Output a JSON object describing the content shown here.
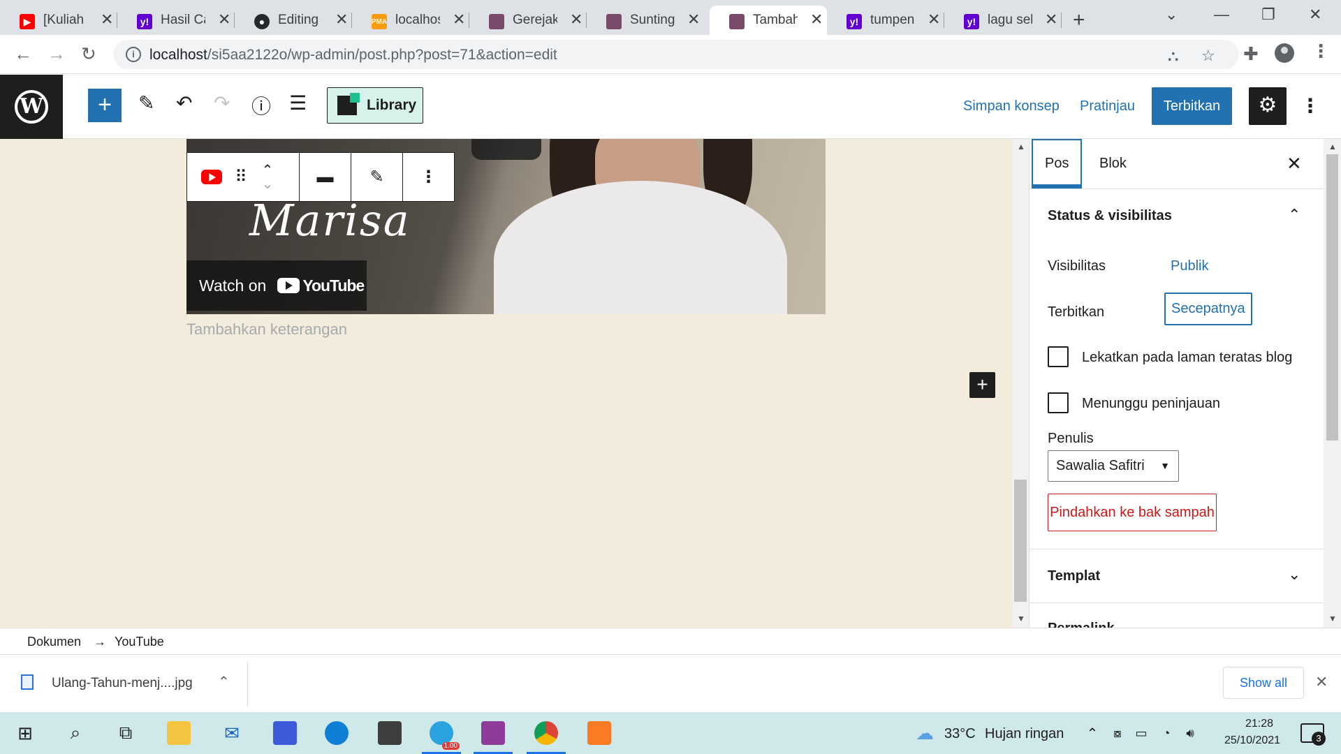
{
  "browser": {
    "tabs": [
      {
        "title": "[Kuliah C",
        "icon": "youtube-icon",
        "color": "#ff0000"
      },
      {
        "title": "Hasil Car",
        "icon": "yahoo-icon",
        "color": "#6001d2"
      },
      {
        "title": "Editing si",
        "icon": "github-icon",
        "color": "#24292e"
      },
      {
        "title": "localhost",
        "icon": "phpmyadmin-icon",
        "color": "#f89c0e"
      },
      {
        "title": "Gerejaku",
        "icon": "avatar-icon",
        "color": "#7a4a6a"
      },
      {
        "title": "Sunting",
        "icon": "avatar-icon",
        "color": "#7a4a6a"
      },
      {
        "title": "Tambahk",
        "icon": "avatar-icon",
        "color": "#7a4a6a"
      },
      {
        "title": "tumpeng",
        "icon": "yahoo-icon",
        "color": "#6001d2"
      },
      {
        "title": "lagu sela",
        "icon": "yahoo-icon",
        "color": "#6001d2"
      }
    ],
    "active_tab": 6,
    "url_host": "localhost",
    "url_path": "/si5aa2122o/wp-admin/post.php?post=71&action=edit"
  },
  "editor": {
    "library_label": "Library",
    "save_draft": "Simpan konsep",
    "preview": "Pratinjau",
    "publish": "Terbitkan"
  },
  "canvas": {
    "video_script_text": "Marisa",
    "watch_on": "Watch on",
    "youtube_word": "YouTube",
    "caption_placeholder": "Tambahkan keterangan"
  },
  "sidebar": {
    "tab_post": "Pos",
    "tab_block": "Blok",
    "status_heading": "Status & visibilitas",
    "visibility_label": "Visibilitas",
    "visibility_value": "Publik",
    "publish_label": "Terbitkan",
    "publish_value": "Secepatnya",
    "sticky_label": "Lekatkan pada laman teratas blog",
    "pending_label": "Menunggu peninjauan",
    "author_label": "Penulis",
    "author_value": "Sawalia Safitri",
    "trash_label": "Pindahkan ke bak sampah",
    "template_heading": "Templat",
    "next_heading_partial": "Permalink"
  },
  "breadcrumb": {
    "root": "Dokumen",
    "arrow": "→",
    "current": "YouTube"
  },
  "downloads": {
    "file": "Ulang-Tahun-menj....jpg",
    "show_all": "Show all"
  },
  "taskbar": {
    "temperature": "33°C",
    "weather": "Hujan ringan",
    "time": "21:28",
    "date": "25/10/2021",
    "notifications": "3",
    "telegram_badge": "1.00"
  }
}
